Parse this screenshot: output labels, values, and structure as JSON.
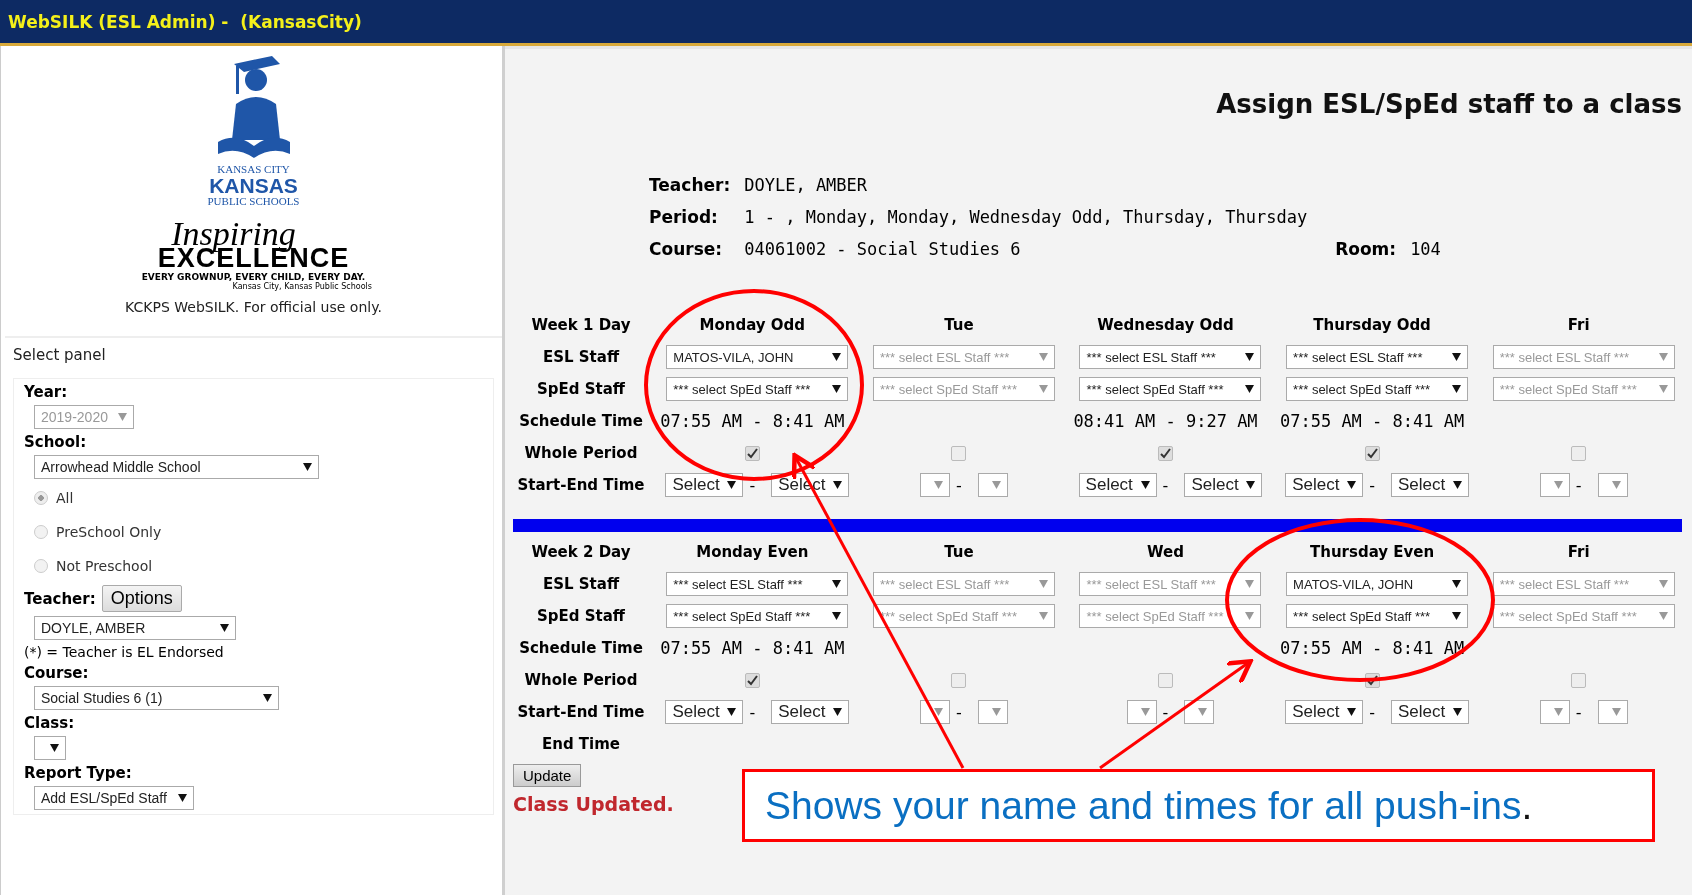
{
  "title_bar": {
    "title": "WebSILK (ESL Admin) -  (KansasCity)"
  },
  "sidebar": {
    "logo": {
      "line_1": "KANSAS CITY",
      "line_2": "KANSAS",
      "line_3": "PUBLIC SCHOOLS",
      "script": "Inspiring",
      "wordmark": "EXCELLENCE",
      "tagline": "EVERY GROWNUP, EVERY CHILD, EVERY DAY.",
      "credit": "Kansas City, Kansas Public Schools"
    },
    "notice": "KCKPS WebSILK. For official use only.",
    "panel_title": "Select panel",
    "year": {
      "label": "Year:",
      "value": "2019-2020",
      "disabled": true
    },
    "school": {
      "label": "School:",
      "value": "Arrowhead Middle School",
      "disabled": false
    },
    "school_filter": [
      {
        "label": "All",
        "selected": true
      },
      {
        "label": "PreSchool Only",
        "selected": false
      },
      {
        "label": "Not Preschool",
        "selected": false
      }
    ],
    "teacher": {
      "label": "Teacher:",
      "button": "Options",
      "value": "DOYLE, AMBER",
      "note": "(*) = Teacher is EL Endorsed"
    },
    "course": {
      "label": "Course:",
      "value": "Social Studies 6 (1)"
    },
    "class": {
      "label": "Class:"
    },
    "report_type": {
      "label": "Report Type:",
      "value": "Add ESL/SpEd Staff"
    }
  },
  "main": {
    "heading": "Assign ESL/SpEd staff to a class",
    "teacher": {
      "label": "Teacher:",
      "value": "DOYLE, AMBER"
    },
    "period": {
      "label": "Period:",
      "value": "1 - , Monday, Monday, Wednesday Odd, Thursday, Thursday"
    },
    "course": {
      "label": "Course:",
      "value": "04061002 - Social Studies 6"
    },
    "room": {
      "label": "Room:",
      "value": "104"
    },
    "weeks": [
      {
        "range_separator": "-",
        "row_labels": [
          "Week 1 Day",
          "ESL Staff",
          "SpEd Staff",
          "Schedule Time",
          "Whole Period",
          "Start-End Time"
        ],
        "days": [
          {
            "name": "Monday Odd",
            "esl": "MATOS-VILA, JOHN",
            "sped": "*** select SpEd Staff ***",
            "schedule_time": "07:55 AM - 8:41 AM",
            "whole_period": true,
            "disabled": false,
            "start": "Select",
            "end": "Select"
          },
          {
            "name": "Tue",
            "esl": "*** select ESL Staff ***",
            "sped": "*** select SpEd Staff ***",
            "whole_period": false,
            "disabled": true
          },
          {
            "name": "Wednesday Odd",
            "esl": "*** select ESL Staff ***",
            "sped": "*** select SpEd Staff ***",
            "schedule_time": "08:41 AM - 9:27 AM",
            "whole_period": true,
            "disabled": false,
            "start": "Select",
            "end": "Select"
          },
          {
            "name": "Thursday Odd",
            "esl": "*** select ESL Staff ***",
            "sped": "*** select SpEd Staff ***",
            "schedule_time": "07:55 AM - 8:41 AM",
            "whole_period": true,
            "disabled": false,
            "start": "Select",
            "end": "Select"
          },
          {
            "name": "Fri",
            "esl": "*** select ESL Staff ***",
            "sped": "*** select SpEd Staff ***",
            "whole_period": false,
            "disabled": true
          }
        ]
      },
      {
        "range_separator": "-",
        "row_labels": [
          "Week 2 Day",
          "ESL Staff",
          "SpEd Staff",
          "Schedule Time",
          "Whole Period",
          "Start-End Time",
          "End Time"
        ],
        "days": [
          {
            "name": "Monday Even",
            "esl": "*** select ESL Staff ***",
            "sped": "*** select SpEd Staff ***",
            "schedule_time": "07:55 AM - 8:41 AM",
            "whole_period": true,
            "disabled": false,
            "start": "Select",
            "end": "Select"
          },
          {
            "name": "Tue",
            "esl": "*** select ESL Staff ***",
            "sped": "*** select SpEd Staff ***",
            "whole_period": false,
            "disabled": true
          },
          {
            "name": "Wed",
            "esl": "*** select ESL Staff ***",
            "sped": "*** select SpEd Staff ***",
            "whole_period": false,
            "disabled": true
          },
          {
            "name": "Thursday Even",
            "esl": "MATOS-VILA, JOHN",
            "sped": "*** select SpEd Staff ***",
            "schedule_time": "07:55 AM - 8:41 AM",
            "whole_period": true,
            "disabled": false,
            "start": "Select",
            "end": "Select"
          },
          {
            "name": "Fri",
            "esl": "*** select ESL Staff ***",
            "sped": "*** select SpEd Staff ***",
            "whole_period": false,
            "disabled": true
          }
        ]
      }
    ],
    "update_button": "Update",
    "status": "Class Updated."
  },
  "callout": {
    "text": "Shows your name and times for all push-ins",
    "end_mark": "."
  }
}
